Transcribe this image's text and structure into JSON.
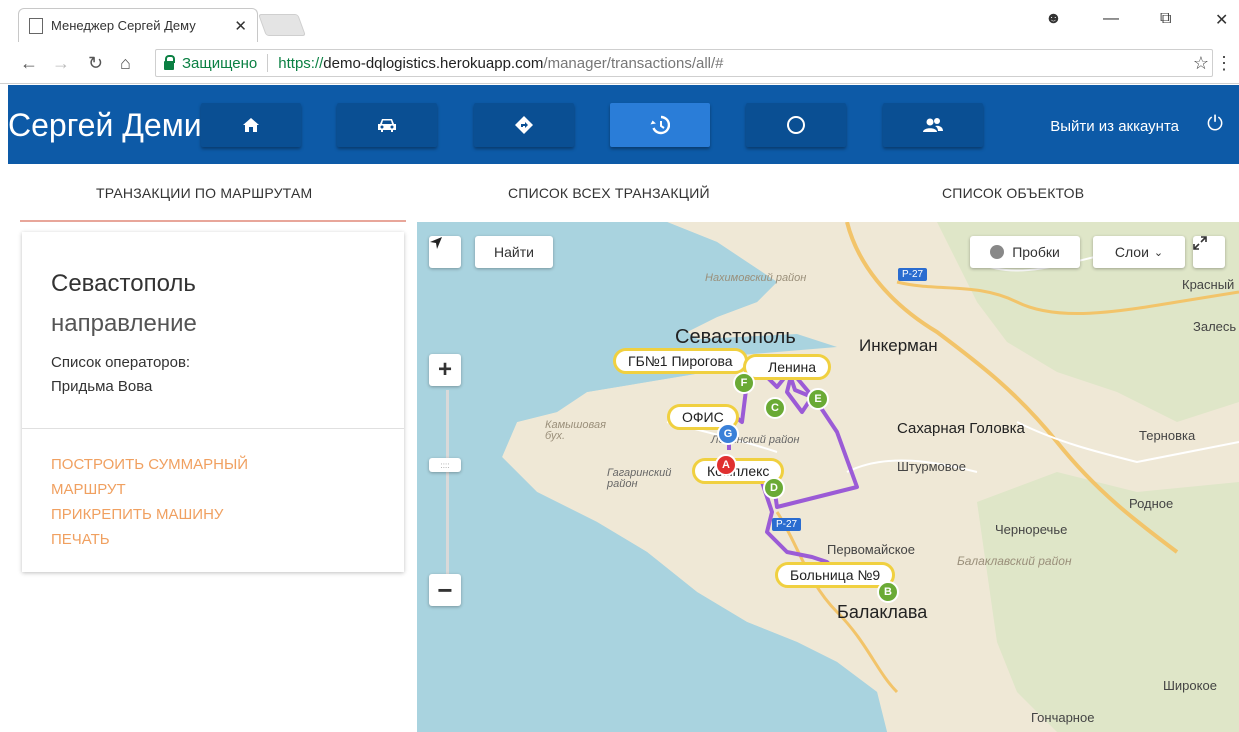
{
  "browser": {
    "tab_title": "Менеджер Сергей Дему",
    "secure_label": "Защищено",
    "url_scheme": "https://",
    "url_host": "demo-dqlogistics.herokuapp.com",
    "url_path": "/manager/transactions/all/#"
  },
  "header": {
    "app_name": "Сергей Демидов",
    "logout_label": "Выйти из аккаунта",
    "nav": [
      "home-icon",
      "car-icon",
      "route-icon",
      "history-icon",
      "circle-icon",
      "users-icon"
    ],
    "active_nav": "history-icon"
  },
  "subnav": {
    "tabs": [
      "ТРАНЗАКЦИИ ПО МАРШРУТАМ",
      "СПИСОК ВСЕХ ТРАНЗАКЦИЙ",
      "СПИСОК ОБЪЕКТОВ"
    ]
  },
  "card": {
    "city": "Севастополь",
    "direction_label": "направление",
    "operators_label": "Список операторов:",
    "operator_name": "Придьма Вова",
    "actions": [
      "ПОСТРОИТЬ СУММАРНЫЙ МАРШРУТ",
      "ПРИКРЕПИТЬ МАШИНУ",
      "ПЕЧАТЬ"
    ]
  },
  "map": {
    "find_label": "Найти",
    "traffic_label": "Пробки",
    "layers_label": "Слои",
    "road_badge_1": "Р-27",
    "road_badge_2": "Р-27",
    "places": {
      "nakhimov": "Нахимовский район",
      "sevastopol": "Севастополь",
      "inkerman": "Инкерман",
      "krasny": "Красный",
      "zalesye": "Залесь",
      "kamyshovaya": "Камышовая бух.",
      "leninsky": "Ленинский район",
      "gagarinsky": "Гагаринский район",
      "sakharnaya": "Сахарная Головка",
      "ternovka": "Терновка",
      "shturmovoe": "Штурмовое",
      "rodnoe": "Родное",
      "chernorechye": "Черноречье",
      "pervomayskoe": "Первомайское",
      "balaklavsky": "Балаклавский район",
      "balaklava": "Балаклава",
      "shirokoe": "Широкое",
      "goncharnoe": "Гончарное"
    },
    "pins": {
      "gbn1": "ГБ№1 Пирогова",
      "lenina": "Ленина",
      "office": "ОФИС",
      "kompleks": "Комплекс",
      "hospital9": "Больница №9"
    },
    "markers": [
      "A",
      "B",
      "C",
      "D",
      "E",
      "F",
      "G"
    ],
    "colors": {
      "route": "#9b5bd6",
      "water": "#a9d3df",
      "land": "#efe8d6",
      "pin_green": "#6aaa35",
      "pin_blue": "#3a80d8",
      "pin_red": "#e03030",
      "label_border": "#f0d040"
    }
  }
}
